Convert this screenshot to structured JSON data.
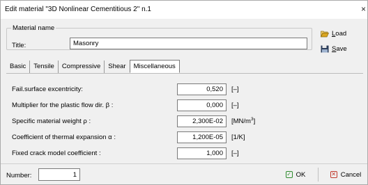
{
  "window": {
    "title": "Edit material  \"3D Nonlinear Cementitious 2\" n.1",
    "close": "×"
  },
  "material_name": {
    "legend": "Material name",
    "title_label": "Title:",
    "title_value": "Masonry"
  },
  "buttons": {
    "load_first": "L",
    "load_rest": "oad",
    "save_first": "S",
    "save_rest": "ave",
    "ok": "OK",
    "cancel": "Cancel"
  },
  "tabs": [
    {
      "label": "Basic"
    },
    {
      "label": "Tensile"
    },
    {
      "label": "Compressive"
    },
    {
      "label": "Shear"
    },
    {
      "label": "Miscellaneous",
      "active": true
    }
  ],
  "params": [
    {
      "label": "Fail.surface excentricity:",
      "value": "0,520",
      "unit": "[–]"
    },
    {
      "label": "Multiplier for the plastic flow dir. β :",
      "value": "0,000",
      "unit": "[–]"
    },
    {
      "label": "Specific material weight ρ :",
      "value": "2,300E-02",
      "unit": "[MN/m",
      "unit_sup": "3",
      "unit_end": "]"
    },
    {
      "label": "Coefficient of thermal expansion α :",
      "value": "1,200E-05",
      "unit": "[1/K]"
    },
    {
      "label": "Fixed crack model coefficient :",
      "value": "1,000",
      "unit": "[–]"
    }
  ],
  "footer": {
    "number_label": "Number:",
    "number_value": "1"
  },
  "colors": {
    "ok_accent": "#2e8b2e",
    "cancel_accent": "#c0392b",
    "load_folder": "#d9a520",
    "save_disk": "#2b3d5a"
  },
  "icons": {
    "load": "open-folder-icon",
    "save": "floppy-disk-icon",
    "ok": "check-icon",
    "cancel": "x-icon"
  }
}
